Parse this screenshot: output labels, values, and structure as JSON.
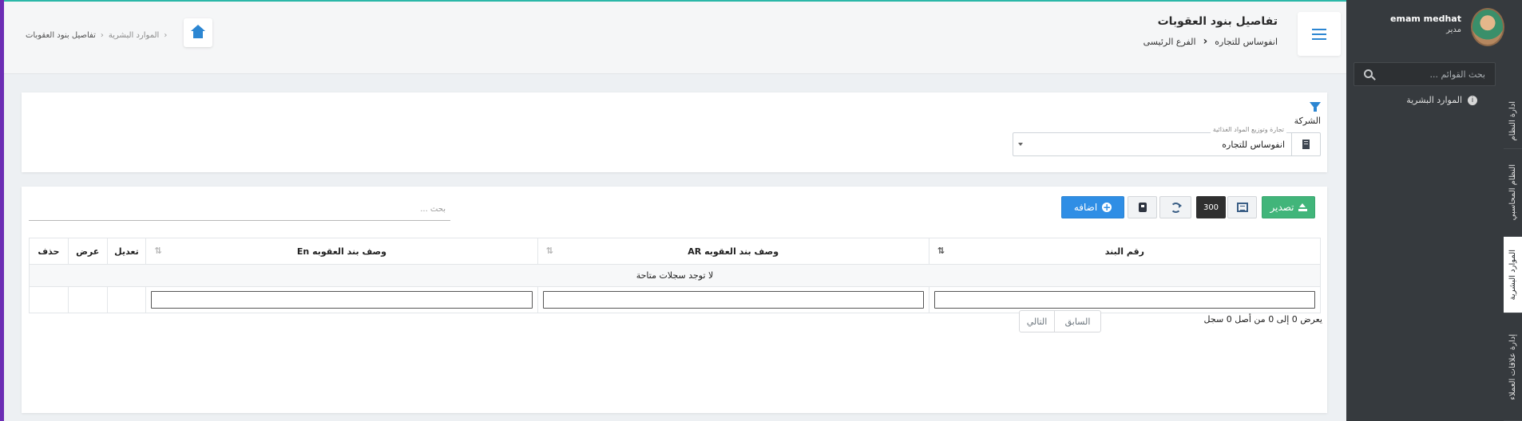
{
  "header": {
    "title": "تفاصيل بنود العقوبات",
    "sub_company": "انفوساس للتجاره",
    "sub_branch": "الفرع الرئيسى",
    "breadcrumb": {
      "parent": "الموارد البشرية",
      "current": "تفاصيل بنود العقوبات"
    }
  },
  "sidebar": {
    "user_name": "emam medhat",
    "user_role": "مدير",
    "search_placeholder": "بحث القوائم ...",
    "menu_item": "الموارد البشرية",
    "vertical_tabs": [
      {
        "label": "ادارة النظام",
        "active": false
      },
      {
        "label": "النظام المحاسبي",
        "active": false
      },
      {
        "label": "الموارد البشرية",
        "active": true
      },
      {
        "label": "إدارة علاقات العملاء",
        "active": false
      }
    ]
  },
  "filter": {
    "label": "الشركة",
    "select_float_label": "تجارة وتوزيع المواد الغذائية",
    "select_value": "انفوساس للتجاره"
  },
  "toolbar": {
    "export_label": "تصدير",
    "page_size": "300",
    "add_label": "اضافه",
    "search_placeholder": "بحث ..."
  },
  "table": {
    "columns": [
      "رقم البند",
      "وصف بند العقوبه AR",
      "وصف بند العقوبه En",
      "تعديل",
      "عرض",
      "حذف"
    ],
    "empty_message": "لا توجد سجلات متاحة",
    "info": "يعرض 0 إلى 0 من أصل 0 سجل",
    "prev_label": "السابق",
    "next_label": "التالي"
  },
  "colors": {
    "accent_blue": "#2c86d2",
    "export_green": "#41b57a",
    "add_blue": "#2f8ee5",
    "sidebar_bg": "#363a3e",
    "left_accent": "#6c2db4"
  }
}
